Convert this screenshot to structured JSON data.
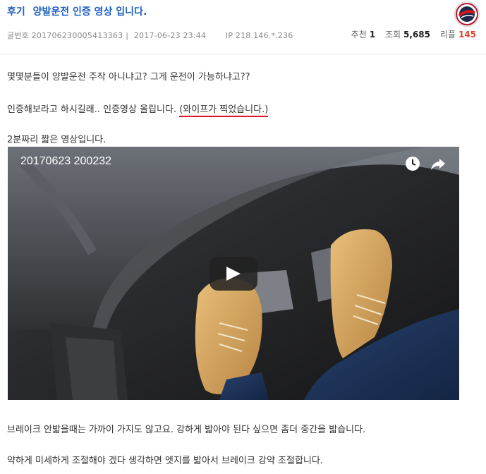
{
  "post": {
    "category": "후기",
    "title": "양발운전 인증 영상 입니다.",
    "meta": {
      "number_label": "글번호",
      "number": "201706230005413363",
      "datetime": "2017-06-23 23:44",
      "ip_label": "IP",
      "ip": "218.146.*.236"
    },
    "stats": {
      "recommend_label": "추천",
      "recommend": "1",
      "views_label": "조회",
      "views": "5,685",
      "replies_label": "리플",
      "replies": "145"
    }
  },
  "content": {
    "line1": "몇몇분들이 양발운전 주작 아니냐고? 그게 운전이 가능하냐고??",
    "line2": "인증해보라고 하시길래.. 인증영상 올립니다. ",
    "line2_highlight": "(와이프가 찍었습니다.)",
    "line3": "2분짜리 짧은 영상입니다.",
    "line4": "브레이크 안밟을때는 가까이 가지도 않고요. 강하게 밟아야 된다 싶으면 좀더 중간을 밟습니다.",
    "line5": "약하게 미세하게 조절해야 겠다 생각하면 엣지를 밟아서 브레이크 강약 조절합니다."
  },
  "video": {
    "title": "20170623 200232",
    "icons": [
      "clock-icon",
      "share-icon",
      "play-icon"
    ]
  },
  "colors": {
    "link_blue": "#1d5fc2",
    "underline_red": "#e3112a",
    "reply_count": "#e0452b"
  }
}
